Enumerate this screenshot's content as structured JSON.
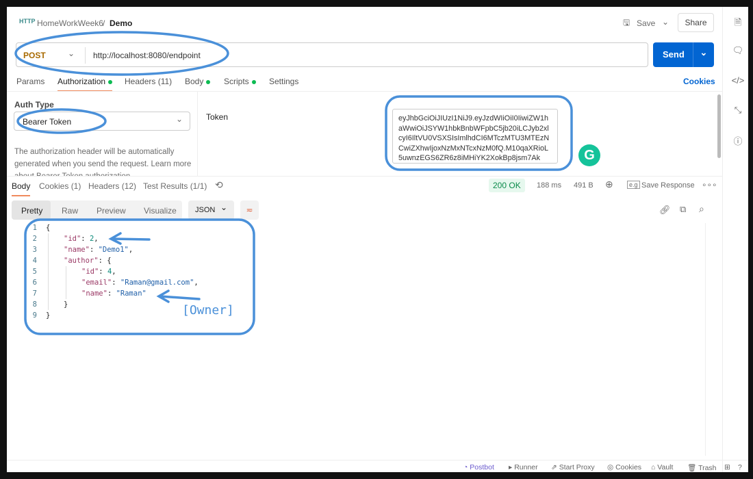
{
  "breadcrumb": {
    "collection": "HomeWorkWeek6",
    "separator": "/",
    "request": "Demo"
  },
  "toolbar": {
    "save": "Save",
    "share": "Share"
  },
  "request": {
    "method": "POST",
    "url": "http://localhost:8080/endpoint",
    "send": "Send"
  },
  "tabs": [
    {
      "label": "Params"
    },
    {
      "label": "Authorization",
      "active": true,
      "dot": true
    },
    {
      "label": "Headers (11)"
    },
    {
      "label": "Body",
      "dot": true
    },
    {
      "label": "Scripts",
      "dot": true
    },
    {
      "label": "Settings"
    }
  ],
  "cookies_link": "Cookies",
  "auth": {
    "type_label": "Auth Type",
    "type_value": "Bearer Token",
    "description": "The authorization header will be automatically generated when you send the request. Learn more about Bearer Token authorization.",
    "token_label": "Token",
    "token_value": "eyJhbGciOiJIUzI1NiJ9.eyJzdWIiOiI0IiwiZW1haWwiOiJSYW1hbkBnbWFpbC5jb20iLCJyb2xlcyI6IltVU0VSXSIsImlhdCI6MTczMTU3MTEzNCwiZXhwIjoxNzMxNTcxNzM0fQ.M10qaXRioL5uwnzEGS6ZR6z8iMHiYK2XokBp8jsm7Ak"
  },
  "response": {
    "tabs": [
      {
        "label": "Body",
        "active": true
      },
      {
        "label": "Cookies (1)"
      },
      {
        "label": "Headers (12)"
      },
      {
        "label": "Test Results (1/1)"
      }
    ],
    "status": "200 OK",
    "time": "188 ms",
    "size": "491 B",
    "save": "Save Response",
    "view_tabs": [
      "Pretty",
      "Raw",
      "Preview",
      "Visualize"
    ],
    "format": "JSON"
  },
  "code_lines": [
    "1",
    "2",
    "3",
    "4",
    "5",
    "6",
    "7",
    "8",
    "9"
  ],
  "json": {
    "id": "2",
    "name": "\"Demo1\"",
    "author_id": "4",
    "email": "\"Raman@gmail.com\"",
    "author_name": "\"Raman\""
  },
  "annotation": "[Owner]",
  "footer": [
    "Postbot",
    "Runner",
    "Start Proxy",
    "Cookies",
    "Vault",
    "Trash"
  ],
  "colors": {
    "accent": "#0265d2",
    "method": "#a86a00",
    "status_ok": "#0a8a4a",
    "annotation": "#4a90d9"
  }
}
